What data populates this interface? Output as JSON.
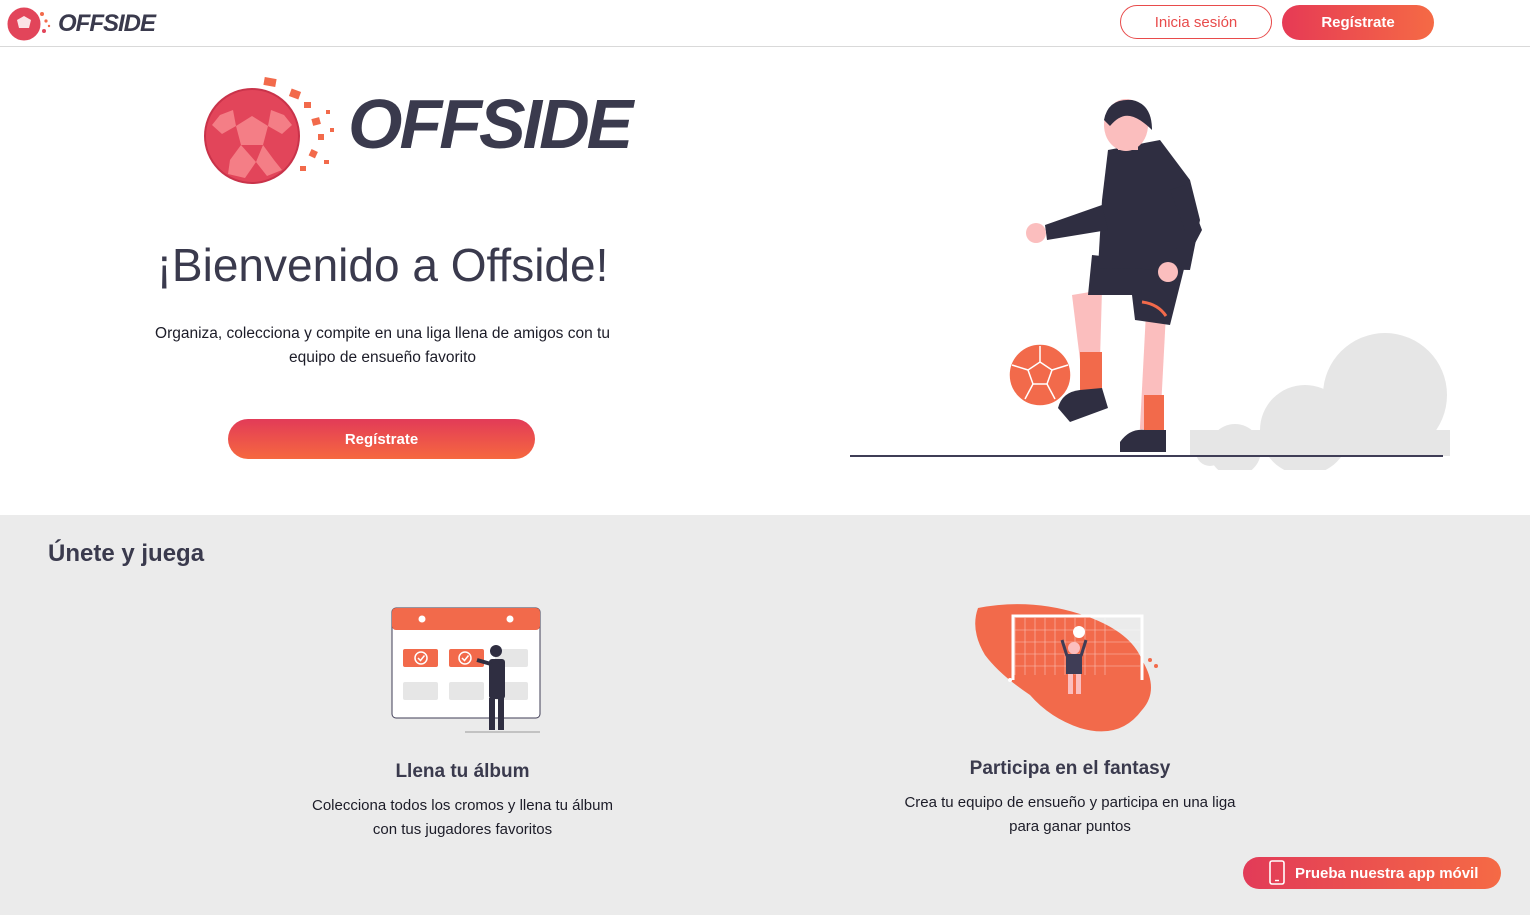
{
  "header": {
    "brand": "OFFSIDE",
    "login_label": "Inicia sesión",
    "signup_label": "Regístrate"
  },
  "hero": {
    "brand": "OFFSIDE",
    "title": "¡Bienvenido a Offside!",
    "subtitle": "Organiza, colecciona y compite en una liga llena de amigos con tu equipo de ensueño favorito",
    "signup_label": "Regístrate"
  },
  "join": {
    "heading": "Únete y juega",
    "features": [
      {
        "title": "Llena tu álbum",
        "description": "Colecciona todos los cromos y llena tu álbum con tus jugadores favoritos",
        "icon": "album-calendar-illustration"
      },
      {
        "title": "Participa en el fantasy",
        "description": "Crea tu equipo de ensueño y participa en una liga para ganar puntos",
        "icon": "goalkeeper-illustration"
      }
    ]
  },
  "app_button": {
    "label": "Prueba nuestra app móvil",
    "icon": "phone-icon"
  },
  "colors": {
    "accent": "#e84b4b",
    "accent_gradient_start": "#e23b58",
    "accent_gradient_end": "#f56a45",
    "dark_text": "#3a3a4d",
    "section_bg": "#ebebeb"
  }
}
